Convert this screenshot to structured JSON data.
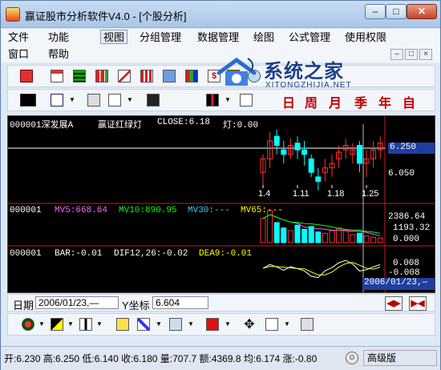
{
  "window": {
    "title": "赢证股市分析软件V4.0 - [个股分析]",
    "min": "–",
    "max": "□",
    "close": "✕"
  },
  "menu": {
    "items": [
      "文件",
      "功能",
      "视图",
      "分组管理",
      "数据管理",
      "绘图",
      "公式管理",
      "使用权限"
    ],
    "row2": [
      "窗口",
      "帮助"
    ],
    "active_index": 2,
    "mdi": [
      "–",
      "□",
      "×"
    ]
  },
  "logo": {
    "title": "系统之家",
    "subtitle": "XITONGZHIJIA.NET"
  },
  "toolbar1": {
    "icons": [
      "exit-icon",
      "calendar-icon",
      "table-icon",
      "bar-chart-icon",
      "chart-up-icon",
      "grid-chart-icon",
      "computer-icon",
      "books-icon",
      "dollar-icon",
      "bag-icon",
      "magnifier-icon"
    ]
  },
  "toolbar2": {
    "icons": [
      "kline-icon",
      "window-icon",
      "refresh-icon",
      "layout-icon",
      "indicator-icon",
      "line-style-icon"
    ],
    "periods": [
      "日",
      "周",
      "月",
      "季",
      "年",
      "自"
    ]
  },
  "toolbar3": {
    "icons": [
      "traffic-light-icon",
      "screen-icon",
      "candle-icon",
      "bar-icon",
      "filter-icon",
      "pen-icon",
      "grid-icon",
      "red-box-icon",
      "move-icon",
      "expand-icon",
      "square-icon"
    ]
  },
  "chart": {
    "main_header": {
      "code": "000001深发展A",
      "indicator": "赢证红绿灯",
      "close": "CLOSE:6.18",
      "lamp": "灯:0.00"
    },
    "vol_header": {
      "code": "000001",
      "mv5": "MV5:668.64",
      "mv10": "MV10:890.95",
      "mv30": "MV30:---",
      "mv65": "MV65:---"
    },
    "macd_header": {
      "code": "000001",
      "bar": "BAR:-0.01",
      "dif": "DIF12,26:-0.02",
      "dea": "DEA9:-0.01"
    },
    "price_axis": [
      "6.250",
      "6.050"
    ],
    "price_highlight": "6.250",
    "vol_axis": [
      "2386.64",
      "1193.32",
      "0.000"
    ],
    "macd_axis": [
      "0.008",
      "-0.008"
    ],
    "date_labels": [
      "1.4",
      "1.11",
      "1.18",
      "1.25"
    ],
    "cursor_date": "2006/01/23,—",
    "colors": {
      "up": "#ff3030",
      "down": "#00ffff",
      "mv5": "#ff66ff",
      "mv10": "#00ff00",
      "mv30": "#33ccff",
      "mv65": "#ffff00"
    }
  },
  "chart_data": {
    "type": "candlestick",
    "x": [
      "1.4",
      "1.5",
      "1.6",
      "1.9",
      "1.10",
      "1.11",
      "1.12",
      "1.13",
      "1.16",
      "1.17",
      "1.18",
      "1.19",
      "1.20",
      "1.23",
      "1.24",
      "1.25",
      "1.26",
      "1.27"
    ],
    "open": [
      6.12,
      6.18,
      6.28,
      6.22,
      6.2,
      6.25,
      6.22,
      6.18,
      6.1,
      6.12,
      6.14,
      6.18,
      6.22,
      6.2,
      6.24,
      6.16,
      6.18,
      6.22
    ],
    "close": [
      6.18,
      6.26,
      6.24,
      6.2,
      6.24,
      6.22,
      6.2,
      6.12,
      6.08,
      6.14,
      6.16,
      6.21,
      6.24,
      6.22,
      6.16,
      6.18,
      6.22,
      6.25
    ],
    "high": [
      6.2,
      6.3,
      6.31,
      6.26,
      6.27,
      6.28,
      6.26,
      6.2,
      6.14,
      6.18,
      6.2,
      6.24,
      6.27,
      6.25,
      6.26,
      6.22,
      6.26,
      6.28
    ],
    "low": [
      6.06,
      6.14,
      6.2,
      6.16,
      6.18,
      6.18,
      6.15,
      6.1,
      6.04,
      6.08,
      6.1,
      6.14,
      6.18,
      6.16,
      6.12,
      6.1,
      6.14,
      6.18
    ],
    "volume": [
      1800,
      2386,
      1500,
      1100,
      900,
      1300,
      1000,
      1200,
      800,
      700,
      900,
      1100,
      950,
      600,
      700,
      500,
      400,
      350
    ],
    "ylim": [
      6.0,
      6.32
    ]
  },
  "info": {
    "date_label": "日期",
    "date_value": "2006/01/23,—",
    "y_label": "Y坐标",
    "y_value": "6.604"
  },
  "status": {
    "text": "开:6.230 高:6.250 低:6.140 收:6.180 量:707.7 额:4369.8 均:6.174 涨:-0.80",
    "mode": "高级版"
  }
}
